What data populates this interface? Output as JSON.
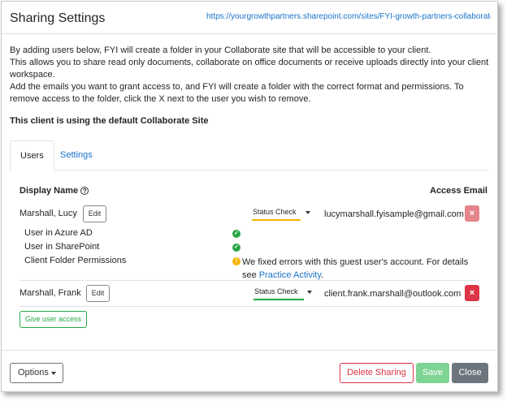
{
  "header": {
    "title": "Sharing Settings",
    "site_link": "https://yourgrowthpartners.sharepoint.com/sites/FYI-growth-partners-collaborate-..."
  },
  "intro": {
    "line1": "By adding users below, FYI will create a folder in your Collaborate site that will be accessible to your client.",
    "line2": "This allows you to share read only documents, collaborate on office documents or receive uploads directly into your client workspace.",
    "line3": "Add the emails you want to grant access to, and FYI will create a folder with the correct format and permissions. To remove access to the folder, click the X next to the user you wish to remove."
  },
  "site_note": "This client is using the default Collaborate Site",
  "tabs": [
    {
      "label": "Users",
      "active": true
    },
    {
      "label": "Settings",
      "active": false
    }
  ],
  "columns": {
    "display_name": "Display Name",
    "access_email": "Access Email"
  },
  "users": [
    {
      "name": "Marshall, Lucy",
      "edit_label": "Edit",
      "status_label": "Status Check",
      "status_color": "#f5b400",
      "email": "lucymarshall.fyisample@gmail.com",
      "delete_label": "×",
      "delete_color": "#e4848c",
      "checks": [
        {
          "label": "User in Azure AD",
          "state": "ok"
        },
        {
          "label": "User in SharePoint",
          "state": "ok"
        },
        {
          "label": "Client Folder Permissions",
          "state": "warn"
        }
      ],
      "warning_text": "We fixed errors with this guest user's account. For details see ",
      "warning_link": "Practice Activity",
      "warning_end": "."
    },
    {
      "name": "Marshall, Frank",
      "edit_label": "Edit",
      "status_label": "Status Check",
      "status_color": "#28a745",
      "email": "client.frank.marshall@outlook.com",
      "delete_label": "×",
      "delete_color": "#dc3545"
    }
  ],
  "give_access_label": "Give user access",
  "footer": {
    "options_label": "Options",
    "delete_sharing_label": "Delete Sharing",
    "save_label": "Save",
    "close_label": "Close"
  },
  "icons": {
    "ok": "check-circle-icon",
    "warn": "exclamation-circle-icon",
    "help": "question-circle-icon"
  }
}
